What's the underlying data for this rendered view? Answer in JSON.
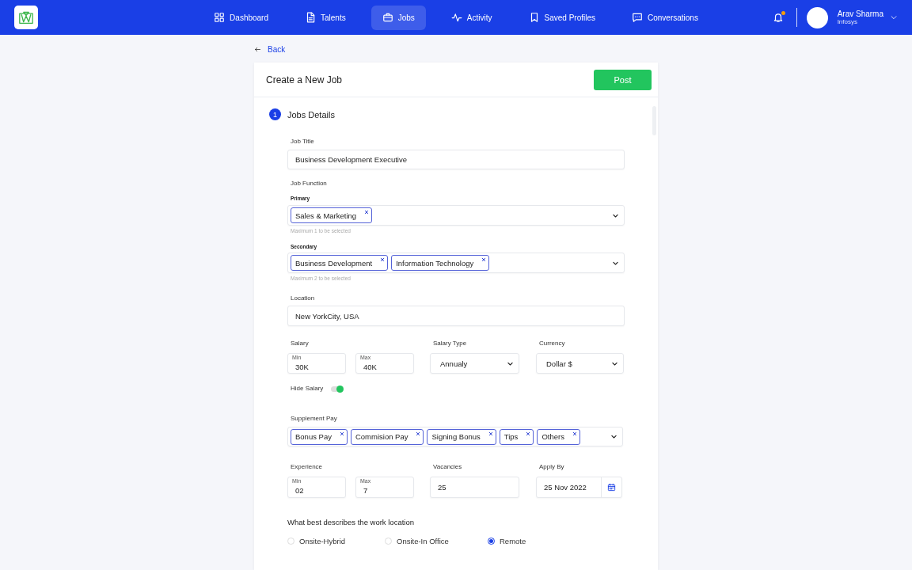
{
  "header": {
    "nav": [
      {
        "label": "Dashboard",
        "selected": false
      },
      {
        "label": "Talents",
        "selected": false
      },
      {
        "label": "Jobs",
        "selected": true
      },
      {
        "label": "Activity",
        "selected": false
      },
      {
        "label": "Saved Profiles",
        "selected": false
      },
      {
        "label": "Conversations",
        "selected": false
      }
    ],
    "notifications": {
      "unread": true
    },
    "user": {
      "name": "Arav Sharma",
      "org": "Infosys"
    }
  },
  "back": "Back",
  "job": {
    "title": "Create a New Job",
    "post": "Post",
    "section": {
      "number": "1",
      "title": "Jobs Details"
    },
    "job_title": {
      "label": "Job Title",
      "value": "Business Development Executive"
    },
    "job_function": {
      "label": "Job Function",
      "primary": {
        "label": "Primary",
        "tags": [
          "Sales & Marketing"
        ],
        "hint": "Maximum 1 to be selected"
      },
      "secondary": {
        "label": "Secondary",
        "tags": [
          "Business Development",
          "Information Technology"
        ],
        "hint": "Maximum 2 to be selected"
      }
    },
    "location": {
      "label": "Location",
      "value": "New YorkCity, USA"
    },
    "salary": {
      "label": "Salary",
      "min": {
        "label": "Min",
        "value": "30K"
      },
      "max": {
        "label": "Max",
        "value": "40K"
      }
    },
    "salary_type": {
      "label": "Salary Type",
      "value": "Annualy"
    },
    "currency": {
      "label": "Currency",
      "value": "Dollar $"
    },
    "hide_salary": {
      "label": "Hide Salary",
      "on": true
    },
    "supplement_pay": {
      "label": "Supplement Pay",
      "tags": [
        "Bonus Pay",
        "Commision Pay",
        "Signing Bonus",
        "Tips",
        "Others"
      ]
    },
    "experience": {
      "label": "Experience",
      "min": {
        "label": "Min",
        "value": "02"
      },
      "max": {
        "label": "Max",
        "value": "7"
      }
    },
    "vacancies": {
      "label": "Vacancies",
      "value": "25"
    },
    "apply_by": {
      "label": "Apply By",
      "value": "25 Nov 2022"
    },
    "work_location": {
      "question": "What best describes the work location",
      "options": [
        {
          "label": "Onsite-Hybrid",
          "selected": false
        },
        {
          "label": "Onsite-In Office",
          "selected": false
        },
        {
          "label": "Remote",
          "selected": true
        }
      ]
    }
  }
}
